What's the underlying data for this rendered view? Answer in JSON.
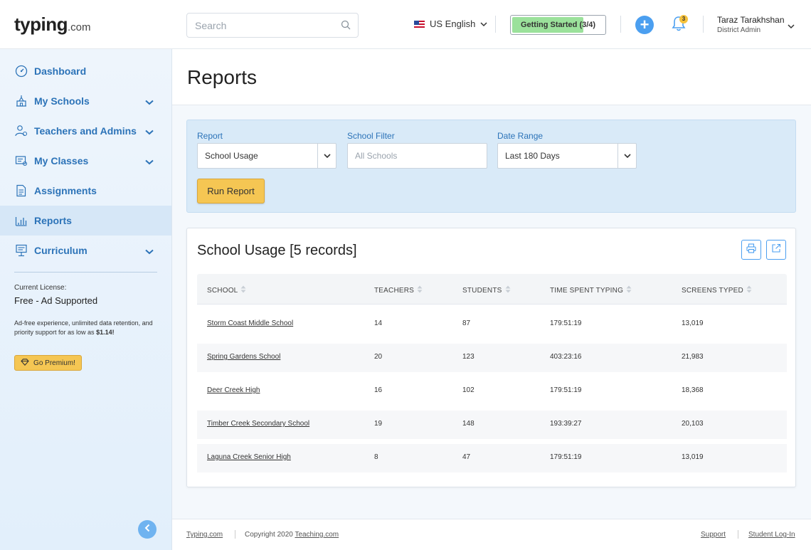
{
  "header": {
    "logo_main": "typing",
    "logo_suffix": ".com",
    "search_placeholder": "Search",
    "language": "US English",
    "getting_started": "Getting Started (3/4)",
    "getting_started_progress": 0.75,
    "add_button": "+",
    "notifications_count": "3",
    "user_name": "Taraz Tarakhshan",
    "user_role": "District Admin"
  },
  "sidebar": {
    "items": [
      {
        "label": "Dashboard",
        "icon": "dashboard-icon"
      },
      {
        "label": "My Schools",
        "icon": "school-icon",
        "expandable": true
      },
      {
        "label": "Teachers and Admins",
        "icon": "teachers-icon",
        "expandable": true
      },
      {
        "label": "My Classes",
        "icon": "classes-icon",
        "expandable": true
      },
      {
        "label": "Assignments",
        "icon": "assignments-icon"
      },
      {
        "label": "Reports",
        "icon": "reports-icon",
        "active": true
      },
      {
        "label": "Curriculum",
        "icon": "curriculum-icon",
        "expandable": true
      }
    ],
    "license_label": "Current License:",
    "license_value": "Free - Ad Supported",
    "license_desc": "Ad-free experience, unlimited data retention, and priority support for as low as",
    "license_price": "$1.14!",
    "premium_button": "Go Premium!"
  },
  "page": {
    "title": "Reports"
  },
  "filters": {
    "report_label": "Report",
    "report_value": "School Usage",
    "school_label": "School Filter",
    "school_placeholder": "All Schools",
    "date_label": "Date Range",
    "date_value": "Last 180 Days",
    "run_button": "Run Report"
  },
  "results": {
    "title": "School Usage [5 records]",
    "columns": [
      "SCHOOL",
      "TEACHERS",
      "STUDENTS",
      "TIME SPENT TYPING",
      "SCREENS TYPED"
    ],
    "rows": [
      [
        "Storm Coast Middle School",
        "14",
        "87",
        "179:51:19",
        "13,019"
      ],
      [
        "Spring Gardens School",
        "20",
        "123",
        "403:23:16",
        "21,983"
      ],
      [
        "Deer Creek High",
        "16",
        "102",
        "179:51:19",
        "18,368"
      ],
      [
        "Timber Creek Secondary School",
        "19",
        "148",
        "193:39:27",
        "20,103"
      ],
      [
        "Laguna Creek Senior High",
        "8",
        "47",
        "179:51:19",
        "13,019"
      ]
    ]
  },
  "footer": {
    "site_link": "Typing.com",
    "copyright": "Copyright 2020",
    "company_link": "Teaching.com",
    "support_link": "Support",
    "student_login": "Student Log-In"
  },
  "colors": {
    "accent": "#2c73b8",
    "button_yellow": "#f5c653",
    "panel_blue": "#d9eaf8",
    "progress_green": "#9be19b"
  }
}
